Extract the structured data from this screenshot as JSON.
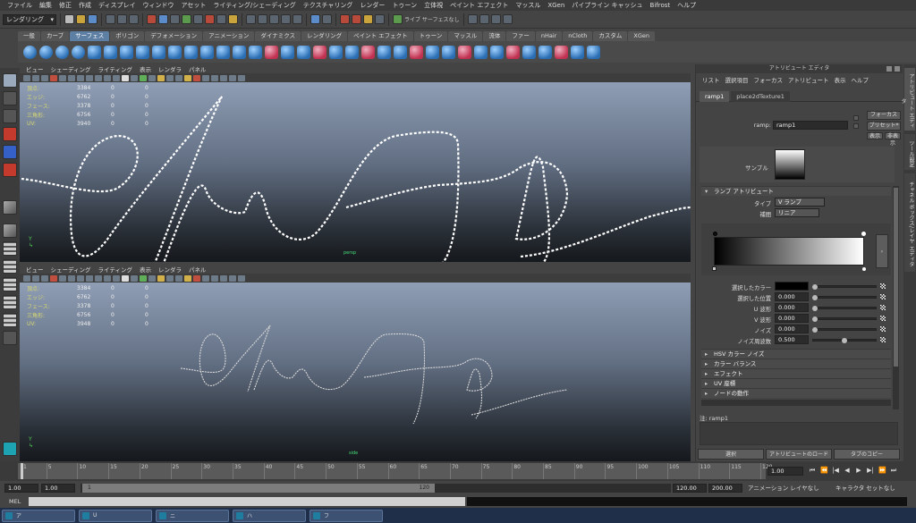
{
  "menubar": [
    "ファイル",
    "編集",
    "修正",
    "作成",
    "ディスプレイ",
    "ウィンドウ",
    "アセット",
    "ライティング/シェーディング",
    "テクスチャリング",
    "レンダー",
    "トゥーン",
    "立体視",
    "ペイント エフェクト",
    "マッスル",
    "XGen",
    "パイプライン キャッシュ",
    "Bifrost",
    "ヘルプ"
  ],
  "statusline": {
    "mode": "レンダリング",
    "render_label": "ライブ サーフェスなし"
  },
  "shelf_tabs": [
    "一般",
    "カーブ",
    "サーフェス",
    "ポリゴン",
    "デフォメーション",
    "アニメーション",
    "ダイナミクス",
    "レンダリング",
    "ペイント エフェクト",
    "トゥーン",
    "マッスル",
    "流体",
    "ファー",
    "nHair",
    "nCloth",
    "カスタム",
    "XGen"
  ],
  "shelf_active": "サーフェス",
  "viewport_menu": [
    "ビュー",
    "シェーディング",
    "ライティング",
    "表示",
    "レンダラ",
    "パネル"
  ],
  "hud": [
    {
      "label": "頂点:",
      "v1": "3384",
      "v2": "0",
      "v3": "0"
    },
    {
      "label": "エッジ:",
      "v1": "6762",
      "v2": "0",
      "v3": "0"
    },
    {
      "label": "フェース:",
      "v1": "3378",
      "v2": "0",
      "v3": "0"
    },
    {
      "label": "三角形:",
      "v1": "6756",
      "v2": "0",
      "v3": "0"
    },
    {
      "label": "UV:",
      "v1": "3940",
      "v2": "0",
      "v3": "0"
    }
  ],
  "hud2": [
    {
      "label": "頂点:",
      "v1": "3384",
      "v2": "0",
      "v3": "0"
    },
    {
      "label": "エッジ:",
      "v1": "6762",
      "v2": "0",
      "v3": "0"
    },
    {
      "label": "フェース:",
      "v1": "3378",
      "v2": "0",
      "v3": "0"
    },
    {
      "label": "三角形:",
      "v1": "6756",
      "v2": "0",
      "v3": "0"
    },
    {
      "label": "UV:",
      "v1": "3948",
      "v2": "0",
      "v3": "0"
    }
  ],
  "viewport_top": {
    "camera": "persp"
  },
  "viewport_bottom": {
    "camera": "side"
  },
  "attribute_editor": {
    "title": "アトリビュート エディタ",
    "menu": [
      "リスト",
      "選択項目",
      "フォーカス",
      "アトリビュート",
      "表示",
      "ヘルプ"
    ],
    "tabs": [
      "ramp1",
      "place2dTexture1"
    ],
    "ramp_label": "ramp:",
    "ramp_value": "ramp1",
    "focus_button": "フォーカス",
    "presets_button": "プリセット*",
    "show_button": "表示",
    "hide_button": "非表示",
    "sample_label": "サンプル",
    "ramp_section": "ランプ アトリビュート",
    "type_label": "タイプ",
    "type_value": "V ランプ",
    "interp_label": "補間",
    "interp_value": "リニア",
    "attrs": [
      {
        "label": "選択したカラー",
        "value": ""
      },
      {
        "label": "選択した位置",
        "value": "0.000"
      },
      {
        "label": "U 波形",
        "value": "0.000"
      },
      {
        "label": "V 波形",
        "value": "0.000"
      },
      {
        "label": "ノイズ",
        "value": "0.000"
      },
      {
        "label": "ノイズ周波数",
        "value": "0.500"
      }
    ],
    "sections": [
      "HSV カラー ノイズ",
      "カラー バランス",
      "エフェクト",
      "UV 座標",
      "ノードの動作"
    ],
    "note_label": "注: ramp1",
    "buttons": [
      "選択",
      "アトリビュートのロード",
      "タブのコピー"
    ]
  },
  "vertical_tabs": [
    "アトリビュート エディタ",
    "ツール設定",
    "チャネル ボックス/レイヤ エディタ"
  ],
  "timeline": {
    "ticks": [
      "1",
      "5",
      "10",
      "15",
      "20",
      "25",
      "30",
      "35",
      "40",
      "45",
      "50",
      "55",
      "60",
      "65",
      "70",
      "75",
      "80",
      "85",
      "90",
      "95",
      "100",
      "105",
      "110",
      "115",
      "120"
    ],
    "current": "1.00"
  },
  "range": {
    "start": "1.00",
    "start2": "1.00",
    "slider_start": "1",
    "slider_end": "120",
    "end": "120.00",
    "end2": "200.00",
    "anim_layer": "アニメーション レイヤなし",
    "char_set": "キャラクタ セットなし"
  },
  "cmdline_label": "MEL",
  "taskbar": [
    {
      "label": "ア"
    },
    {
      "label": "U"
    },
    {
      "label": "ニ"
    },
    {
      "label": "ハ"
    },
    {
      "label": "フ"
    }
  ]
}
